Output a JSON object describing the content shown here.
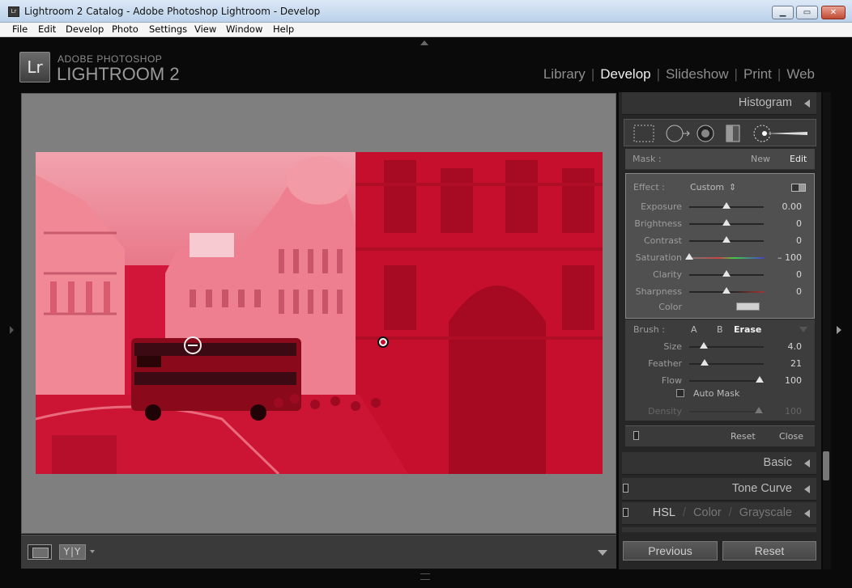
{
  "window": {
    "title": "Lightroom 2 Catalog - Adobe Photoshop Lightroom - Develop",
    "icon": "Lr",
    "min": "▁",
    "max": "▭",
    "close": "✕"
  },
  "menu": [
    "File",
    "Edit",
    "Develop",
    "Photo",
    "Settings",
    "View",
    "Window",
    "Help"
  ],
  "brand": {
    "badge": "Lr",
    "line1": "ADOBE PHOTOSHOP",
    "line2": "LIGHTROOM 2"
  },
  "modules": [
    "Library",
    "Develop",
    "Slideshow",
    "Print",
    "Web"
  ],
  "active_module": "Develop",
  "panels": {
    "histogram": "Histogram",
    "basic": "Basic",
    "tone_curve": "Tone Curve",
    "hsl": {
      "hsl": "HSL",
      "sep": "/",
      "color": "Color",
      "grayscale": "Grayscale"
    }
  },
  "mask": {
    "label": "Mask :",
    "new": "New",
    "edit": "Edit"
  },
  "effect": {
    "label": "Effect :",
    "preset": "Custom",
    "preset_arrows": "⇕",
    "sliders": [
      {
        "label": "Exposure",
        "value": "0.00",
        "position": 0.5
      },
      {
        "label": "Brightness",
        "value": "0",
        "position": 0.5
      },
      {
        "label": "Contrast",
        "value": "0",
        "position": 0.5
      },
      {
        "label": "Saturation",
        "value": "– 100",
        "position": 0.0
      },
      {
        "label": "Clarity",
        "value": "0",
        "position": 0.5
      },
      {
        "label": "Sharpness",
        "value": "0",
        "position": 0.5
      }
    ],
    "color_label": "Color"
  },
  "brush": {
    "label": "Brush :",
    "a": "A",
    "b": "B",
    "erase": "Erase",
    "sliders": [
      {
        "label": "Size",
        "value": "4.0",
        "position": 0.2
      },
      {
        "label": "Feather",
        "value": "21",
        "position": 0.21
      },
      {
        "label": "Flow",
        "value": "100",
        "position": 0.95
      }
    ],
    "auto_mask": "Auto Mask",
    "density": {
      "label": "Density",
      "value": "100",
      "position": 0.95
    }
  },
  "footer": {
    "reset": "Reset",
    "close": "Close"
  },
  "buttons": {
    "previous": "Previous",
    "reset": "Reset"
  },
  "toolbar": {
    "yy": "Y|Y"
  },
  "colors": {
    "mask_overlay": "#c8102e",
    "panel": "#262626",
    "accent_text": "#f0f0f0"
  }
}
